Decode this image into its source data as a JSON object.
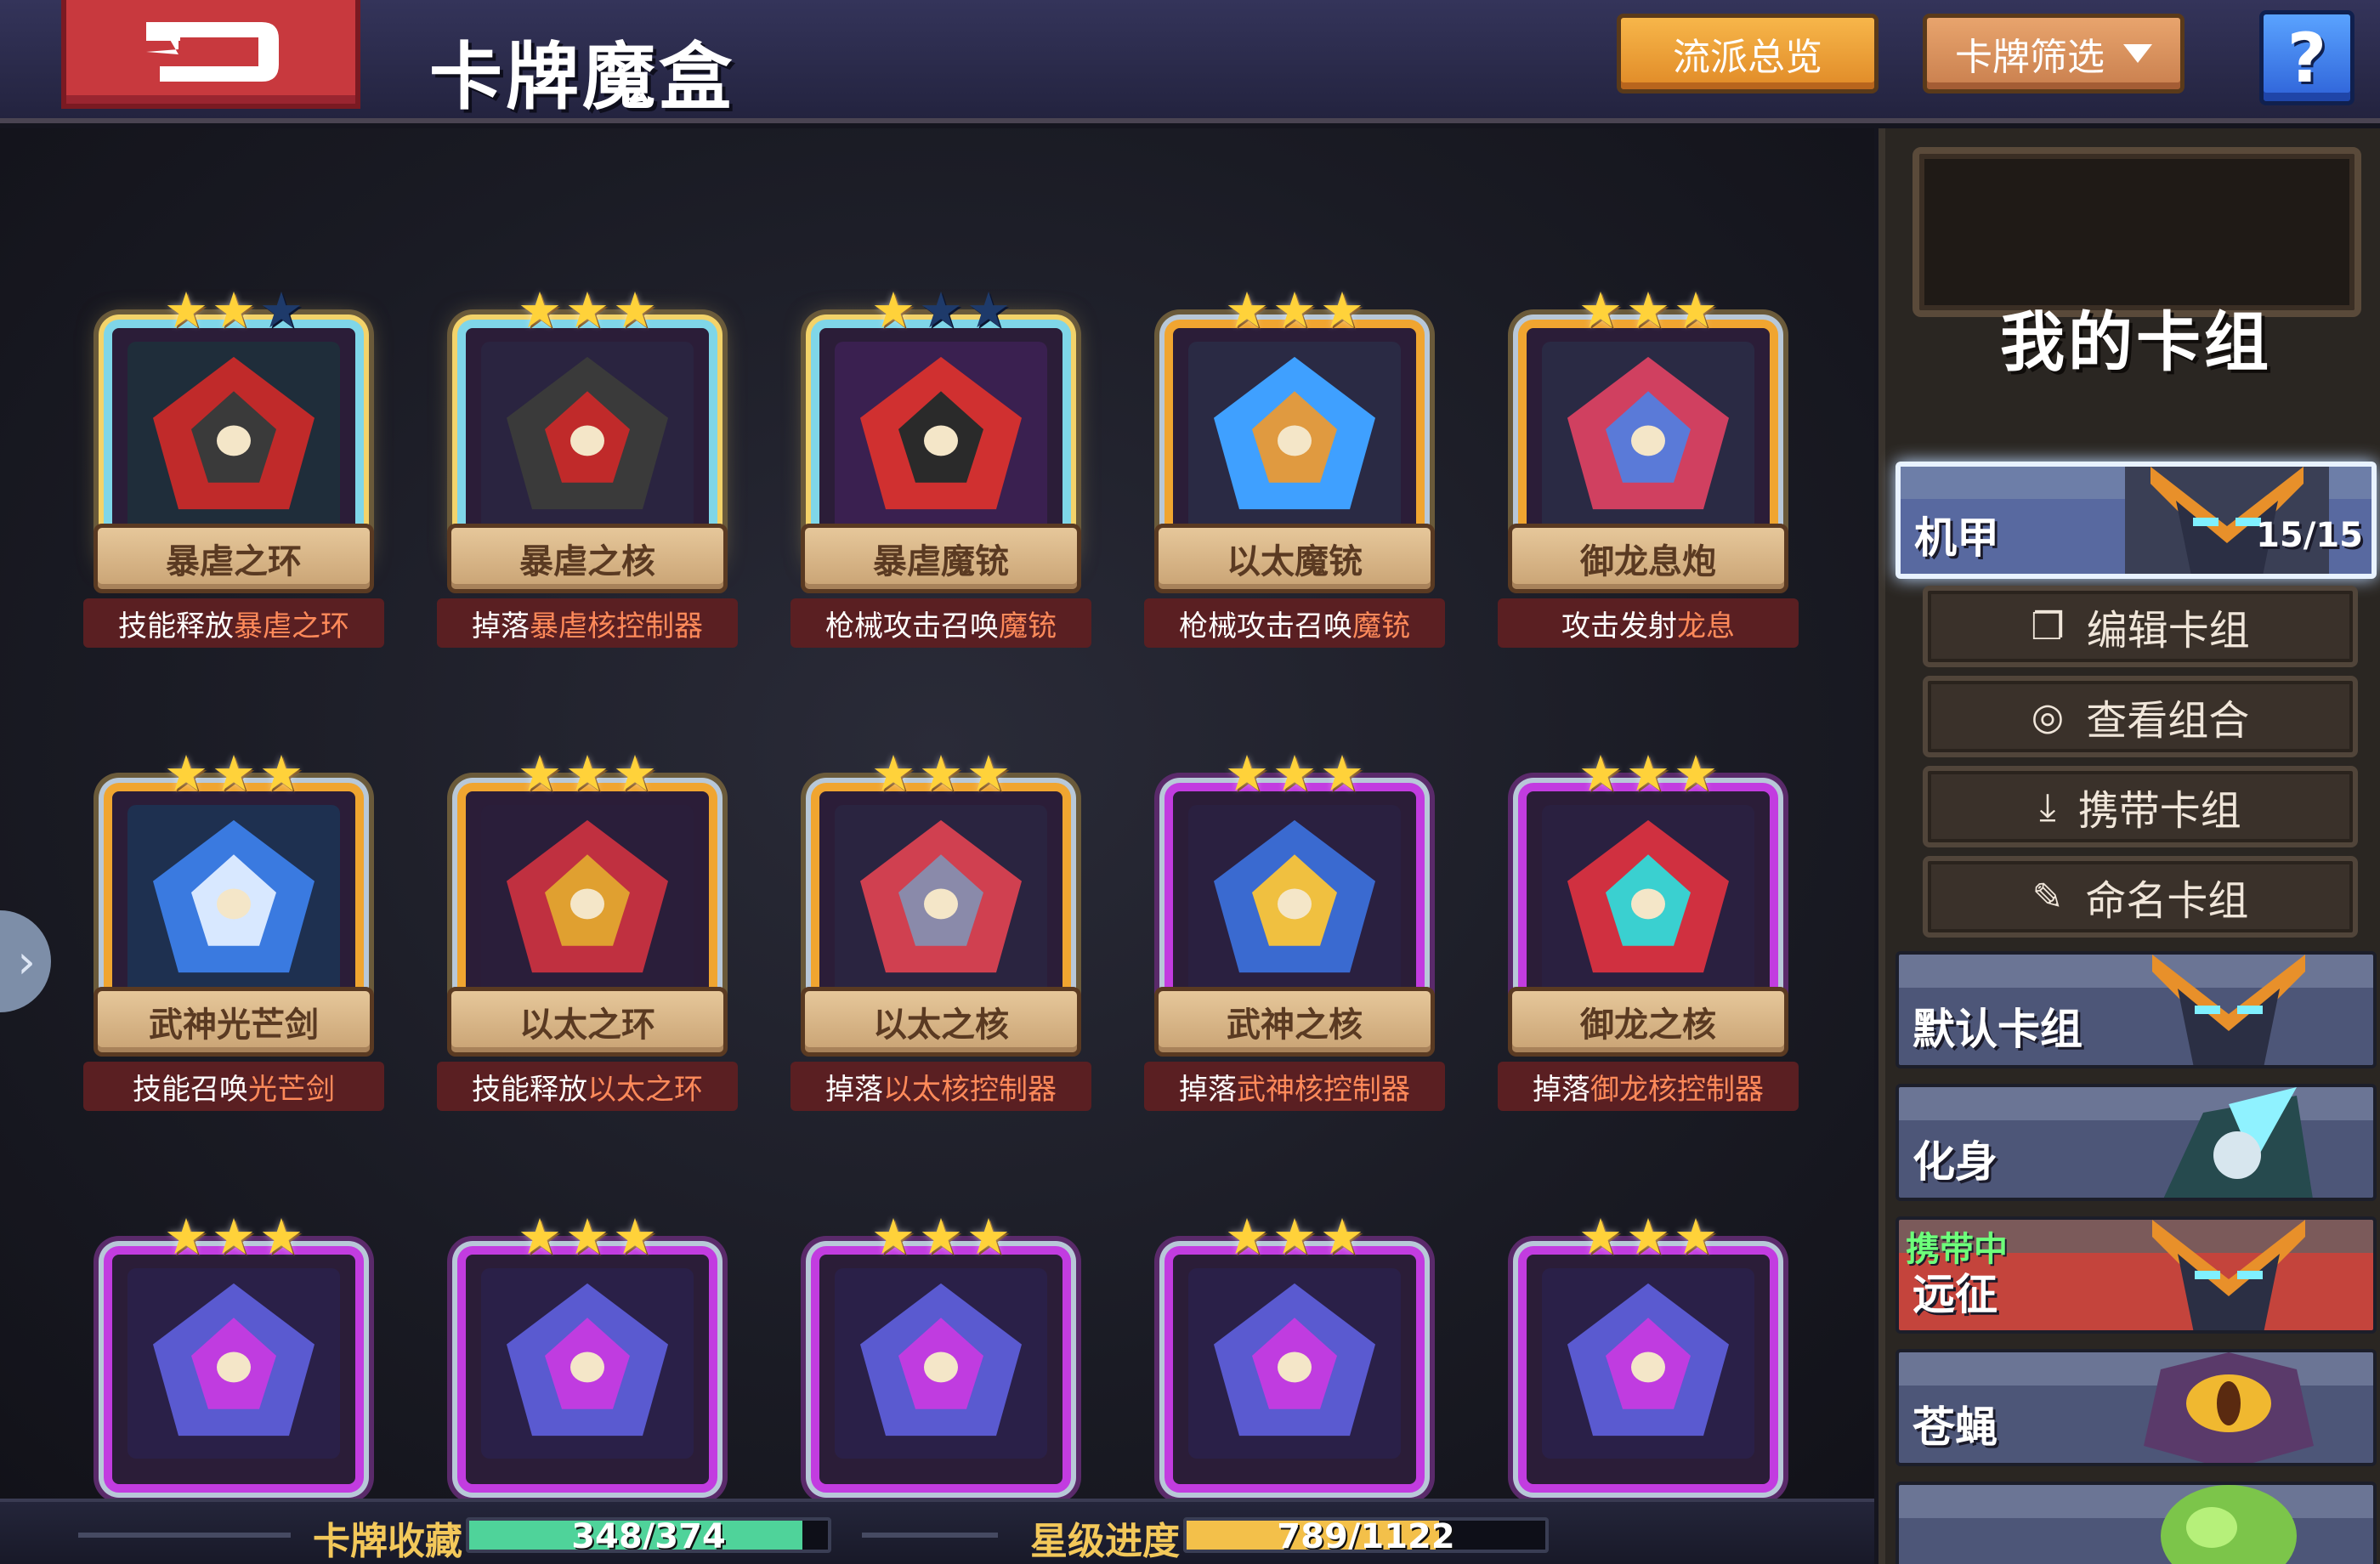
{
  "header": {
    "title": "卡牌魔盒",
    "style_overview_label": "流派总览",
    "card_filter_label": "卡牌筛选",
    "help_label": "?"
  },
  "cards": [
    {
      "name": "暴虐之环",
      "desc_prefix": "技能释放",
      "desc_highlight": "暴虐之环",
      "rarity": "rainbow",
      "stars_filled": 2,
      "stars_total": 3,
      "art": "ring"
    },
    {
      "name": "暴虐之核",
      "desc_prefix": "掉落",
      "desc_highlight": "暴虐核控制器",
      "rarity": "rainbow",
      "stars_filled": 3,
      "stars_total": 3,
      "art": "core"
    },
    {
      "name": "暴虐魔铳",
      "desc_prefix": "枪械攻击召唤",
      "desc_highlight": "魔铳",
      "rarity": "rainbow",
      "stars_filled": 1,
      "stars_total": 3,
      "art": "gun"
    },
    {
      "name": "以太魔铳",
      "desc_prefix": "枪械攻击召唤",
      "desc_highlight": "魔铳",
      "rarity": "legend",
      "stars_filled": 3,
      "stars_total": 3,
      "art": "ether-gun"
    },
    {
      "name": "御龙息炮",
      "desc_prefix": "攻击发射",
      "desc_highlight": "龙息",
      "rarity": "legend",
      "stars_filled": 3,
      "stars_total": 3,
      "art": "dragon-cannon"
    },
    {
      "name": "武神光芒剑",
      "desc_prefix": "技能召唤",
      "desc_highlight": "光芒剑",
      "rarity": "legend",
      "stars_filled": 3,
      "stars_total": 3,
      "art": "sword"
    },
    {
      "name": "以太之环",
      "desc_prefix": "技能释放",
      "desc_highlight": "以太之环",
      "rarity": "legend",
      "stars_filled": 3,
      "stars_total": 3,
      "art": "ether-ring"
    },
    {
      "name": "以太之核",
      "desc_prefix": "掉落",
      "desc_highlight": "以太核控制器",
      "rarity": "legend",
      "stars_filled": 3,
      "stars_total": 3,
      "art": "ether-core"
    },
    {
      "name": "武神之核",
      "desc_prefix": "掉落",
      "desc_highlight": "武神核控制器",
      "rarity": "epic",
      "stars_filled": 3,
      "stars_total": 3,
      "art": "warrior-core"
    },
    {
      "name": "御龙之核",
      "desc_prefix": "掉落",
      "desc_highlight": "御龙核控制器",
      "rarity": "epic",
      "stars_filled": 3,
      "stars_total": 3,
      "art": "dragon-core"
    },
    {
      "name": "",
      "desc_prefix": "",
      "desc_highlight": "",
      "rarity": "epic",
      "stars_filled": 3,
      "stars_total": 3,
      "art": "partial"
    },
    {
      "name": "",
      "desc_prefix": "",
      "desc_highlight": "",
      "rarity": "epic",
      "stars_filled": 3,
      "stars_total": 3,
      "art": "partial"
    },
    {
      "name": "",
      "desc_prefix": "",
      "desc_highlight": "",
      "rarity": "epic",
      "stars_filled": 3,
      "stars_total": 3,
      "art": "partial"
    },
    {
      "name": "",
      "desc_prefix": "",
      "desc_highlight": "",
      "rarity": "epic",
      "stars_filled": 3,
      "stars_total": 3,
      "art": "partial"
    },
    {
      "name": "",
      "desc_prefix": "",
      "desc_highlight": "",
      "rarity": "epic",
      "stars_filled": 3,
      "stars_total": 3,
      "art": "partial"
    }
  ],
  "sidebar": {
    "title": "我的卡组",
    "active_deck": {
      "name": "机甲",
      "count": "15/15"
    },
    "actions": [
      {
        "label": "编辑卡组",
        "icon": "copy-icon"
      },
      {
        "label": "查看组合",
        "icon": "eye-icon"
      },
      {
        "label": "携带卡组",
        "icon": "download-icon"
      },
      {
        "label": "命名卡组",
        "icon": "pencil-icon"
      }
    ],
    "decks": [
      {
        "name": "默认卡组",
        "tag": ""
      },
      {
        "name": "化身",
        "tag": ""
      },
      {
        "name": "远征",
        "tag": "携带中"
      },
      {
        "name": "苍蝇",
        "tag": ""
      },
      {
        "name": "",
        "tag": ""
      }
    ]
  },
  "stats": {
    "collection_label": "卡牌收藏",
    "collection_value": "348/374",
    "collection_fraction": 0.93,
    "star_label": "星级进度",
    "star_value": "789/1122",
    "star_fraction": 0.703
  },
  "colors": {
    "collection_bar": "#4fd39a",
    "star_bar": "#f3c04a",
    "highlight_text": "#ff8a5a"
  }
}
